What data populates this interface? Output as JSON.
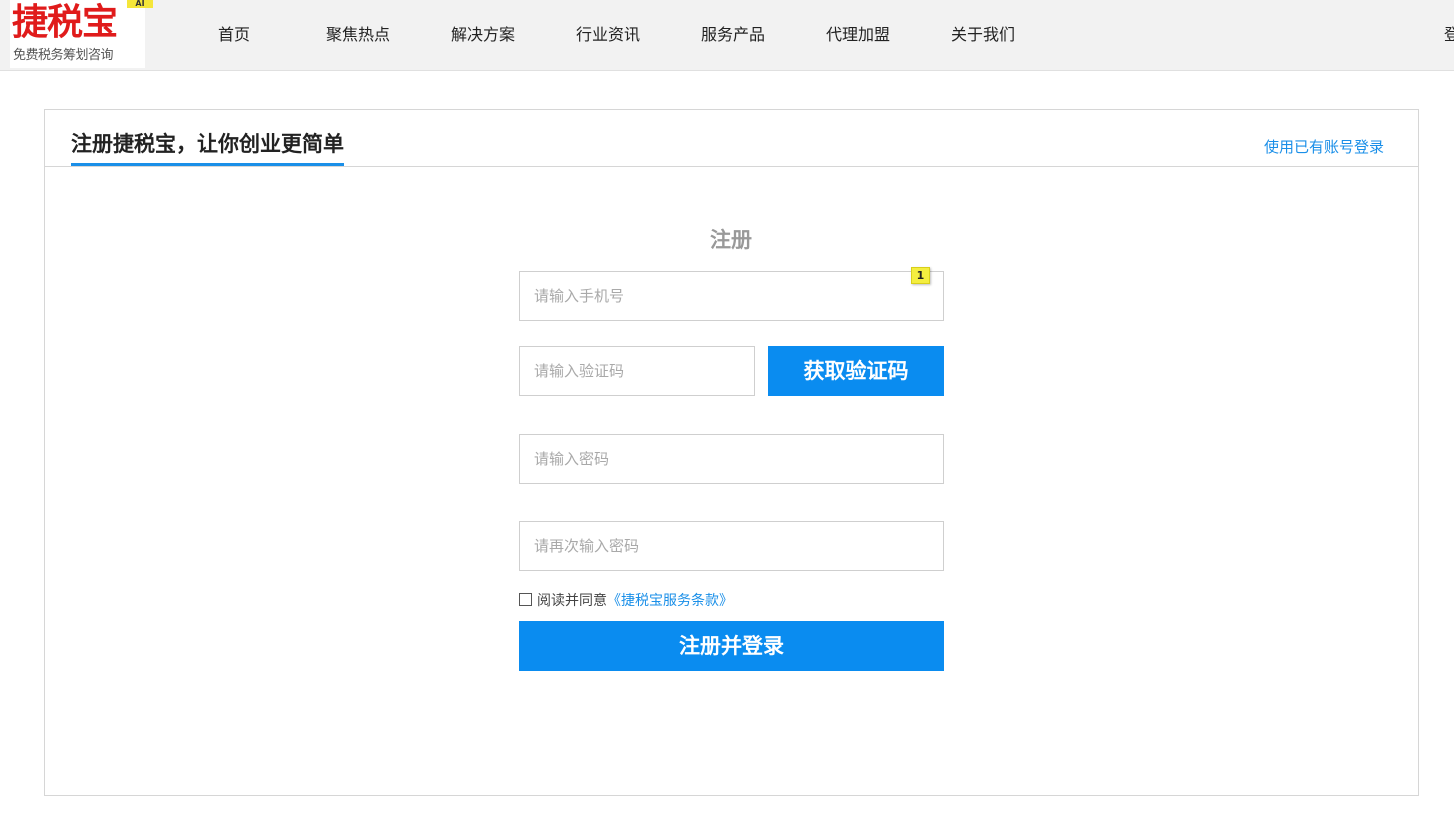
{
  "header": {
    "logo": {
      "badge": "AI",
      "main": "捷税宝",
      "sub": "免费税务筹划咨询"
    },
    "nav": [
      {
        "label": "首页"
      },
      {
        "label": "聚焦热点"
      },
      {
        "label": "解决方案"
      },
      {
        "label": "行业资讯"
      },
      {
        "label": "服务产品"
      },
      {
        "label": "代理加盟"
      },
      {
        "label": "关于我们"
      }
    ],
    "right_label": "登"
  },
  "panel": {
    "title": "注册捷税宝，让你创业更简单",
    "login_link": "使用已有账号登录"
  },
  "form": {
    "title": "注册",
    "phone_placeholder": "请输入手机号",
    "phone_badge": "1",
    "code_placeholder": "请输入验证码",
    "get_code_label": "获取验证码",
    "password_placeholder": "请输入密码",
    "confirm_password_placeholder": "请再次输入密码",
    "agree_text": "阅读并同意",
    "terms_link": "《捷税宝服务条款》",
    "submit_label": "注册并登录"
  },
  "colors": {
    "accent": "#0a8cf0",
    "logo_red": "#e01b1b",
    "header_bg": "#f2f2f2"
  }
}
